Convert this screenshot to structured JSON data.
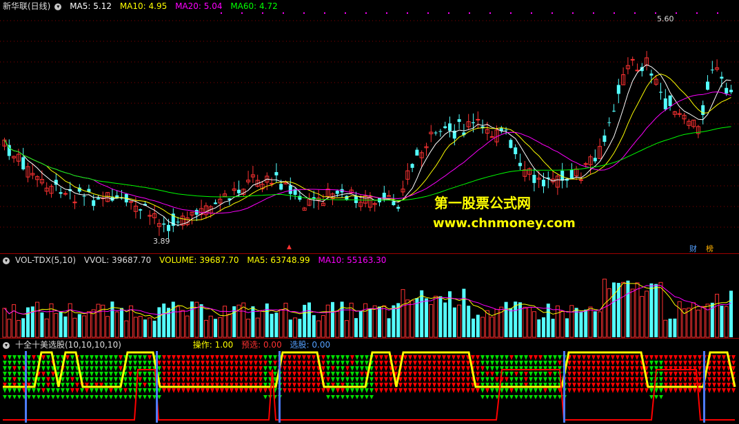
{
  "price_panel": {
    "title": "新华联(日线)",
    "ma5": "MA5: 5.12",
    "ma10": "MA10: 4.95",
    "ma20": "MA20: 5.04",
    "ma60": "MA60: 4.72",
    "high_label": "5.60",
    "low_label": "3.89",
    "tag_cai": "财",
    "tag_bang": "榜",
    "marker_glyph": "▲"
  },
  "volume_panel": {
    "name": "VOL-TDX(5,10)",
    "vvol": "VVOL: 39687.70",
    "volume": "VOLUME: 39687.70",
    "ma5": "MA5: 63748.99",
    "ma10": "MA10: 55163.30"
  },
  "indicator_panel": {
    "name": "十全十美选股(10,10,10,10)",
    "op": "操作: 1.00",
    "pre": "预选: 0.00",
    "sel": "选股: 0.00"
  },
  "watermark": {
    "line1": "第一股票公式网",
    "line2": "www.chnmoney.com"
  },
  "colors": {
    "ma5": "#ffffff",
    "ma10": "#ffff00",
    "ma20": "#ff00ff",
    "ma60": "#00ff00",
    "up": "#ff3232",
    "down": "#54ffff",
    "grid": "#8b0000",
    "indicator_red": "#ff0000",
    "indicator_green": "#00dd00",
    "indicator_yellow": "#ffff00",
    "indicator_blue": "#4d7cff"
  }
}
